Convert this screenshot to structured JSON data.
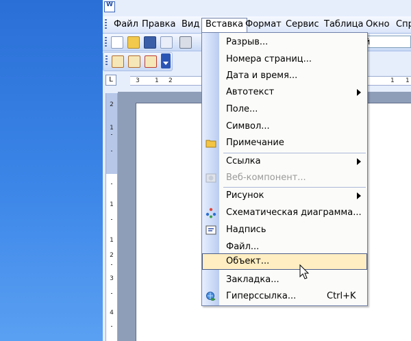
{
  "menubar": {
    "items": [
      {
        "label": "Файл"
      },
      {
        "label": "Правка"
      },
      {
        "label": "Вид"
      },
      {
        "label": "Вставка"
      },
      {
        "label": "Формат"
      },
      {
        "label": "Сервис"
      },
      {
        "label": "Таблица"
      },
      {
        "label": "Окно"
      },
      {
        "label": "Спр"
      }
    ],
    "open_item": "Вставка"
  },
  "toolbar": {
    "font_value": "ый"
  },
  "ruler": {
    "corner": "L",
    "h_numbers": [
      "3",
      "1",
      "2",
      "1",
      "1"
    ],
    "v_numbers": [
      "2",
      "1",
      "1",
      "1",
      "2",
      "3",
      "4"
    ]
  },
  "insert_menu": {
    "items": [
      {
        "label": "Разрыв...",
        "icon": "",
        "submenu": false,
        "disabled": false
      },
      {
        "label": "Номера страниц...",
        "icon": "",
        "submenu": false,
        "disabled": false
      },
      {
        "label": "Дата и время...",
        "icon": "",
        "submenu": false,
        "disabled": false
      },
      {
        "label": "Автотекст",
        "icon": "",
        "submenu": true,
        "disabled": false
      },
      {
        "label": "Поле...",
        "icon": "",
        "submenu": false,
        "disabled": false
      },
      {
        "label": "Символ...",
        "icon": "",
        "submenu": false,
        "disabled": false
      },
      {
        "label": "Примечание",
        "icon": "comment-icon",
        "submenu": false,
        "disabled": false
      },
      {
        "label": "Ссылка",
        "icon": "",
        "submenu": true,
        "disabled": false
      },
      {
        "label": "Веб-компонент...",
        "icon": "web-component-icon",
        "submenu": false,
        "disabled": true
      },
      {
        "label": "Рисунок",
        "icon": "",
        "submenu": true,
        "disabled": false
      },
      {
        "label": "Схематическая диаграмма...",
        "icon": "diagram-icon",
        "submenu": false,
        "disabled": false
      },
      {
        "label": "Надпись",
        "icon": "textbox-icon",
        "submenu": false,
        "disabled": false
      },
      {
        "label": "Файл...",
        "icon": "",
        "submenu": false,
        "disabled": false
      },
      {
        "label": "Объект...",
        "icon": "",
        "submenu": false,
        "disabled": false
      },
      {
        "label": "Закладка...",
        "icon": "",
        "submenu": false,
        "disabled": false
      },
      {
        "label": "Гиперссылка...",
        "icon": "hyperlink-icon",
        "submenu": false,
        "disabled": false,
        "shortcut": "Ctrl+K"
      }
    ],
    "highlighted": "Объект..."
  },
  "colors": {
    "menu_highlight": "#ffeec2",
    "menu_border": "#6e7fa8",
    "toolbar_gradient_top": "#f3f7ff",
    "toolbar_gradient_bottom": "#c9d9f5",
    "desktop": "#3a7bd5"
  }
}
